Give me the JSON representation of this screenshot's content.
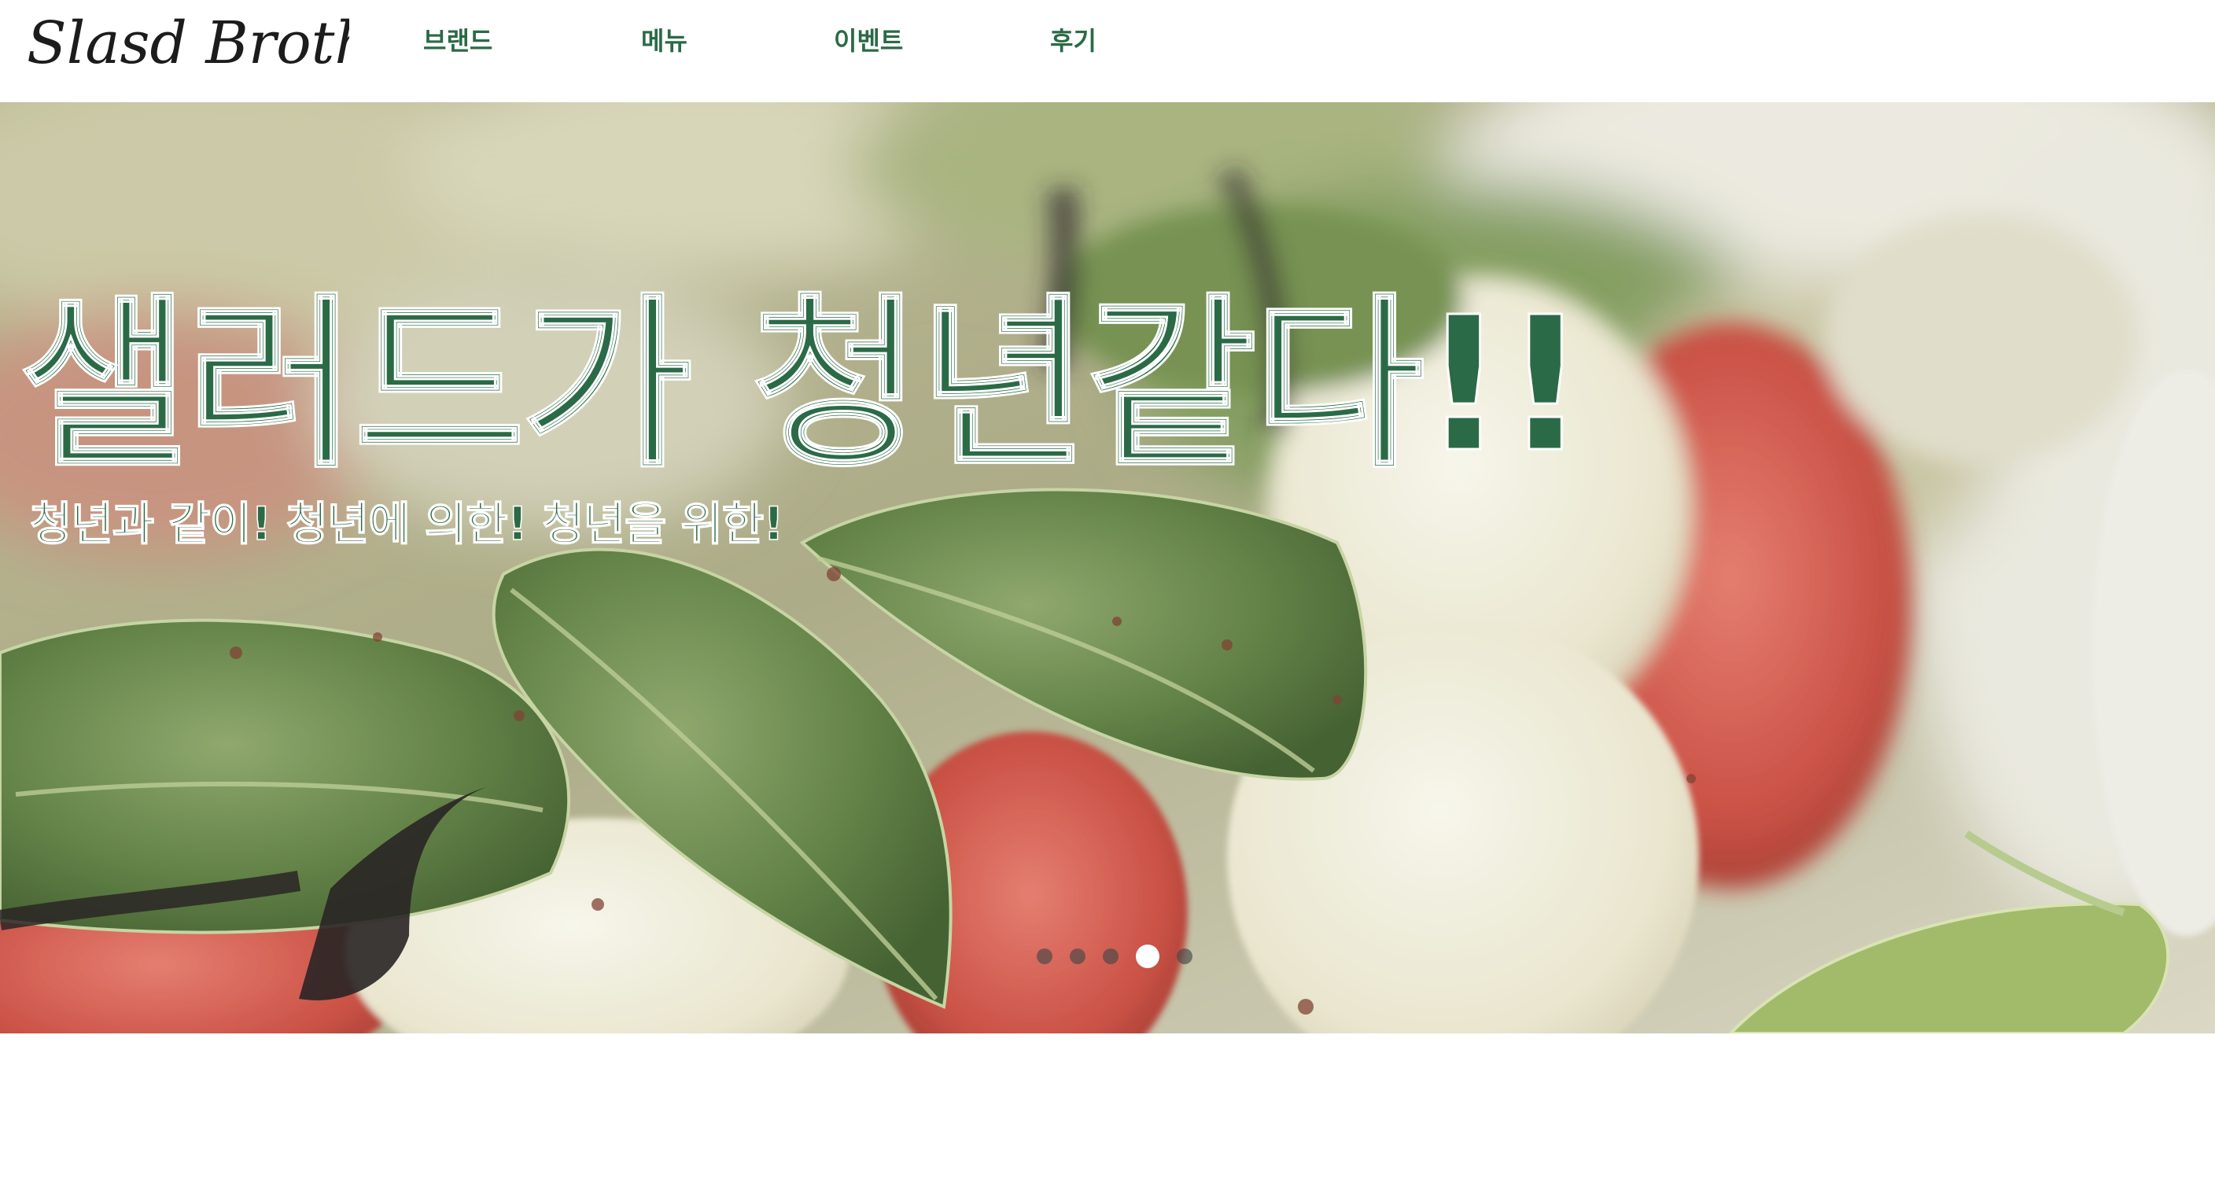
{
  "header": {
    "logo_text": "Slasd Brothers",
    "nav": [
      {
        "label": "브랜드"
      },
      {
        "label": "메뉴"
      },
      {
        "label": "이벤트"
      },
      {
        "label": "후기"
      }
    ]
  },
  "hero": {
    "title": "샐러드가 청년같다!!",
    "subtitle": "청년과 같이! 청년에 의한! 청년을 위한!",
    "slides_total": 5,
    "active_slide": 4
  },
  "colors": {
    "brand_green": "#2b6a46",
    "nav_green": "#2a6a45"
  }
}
